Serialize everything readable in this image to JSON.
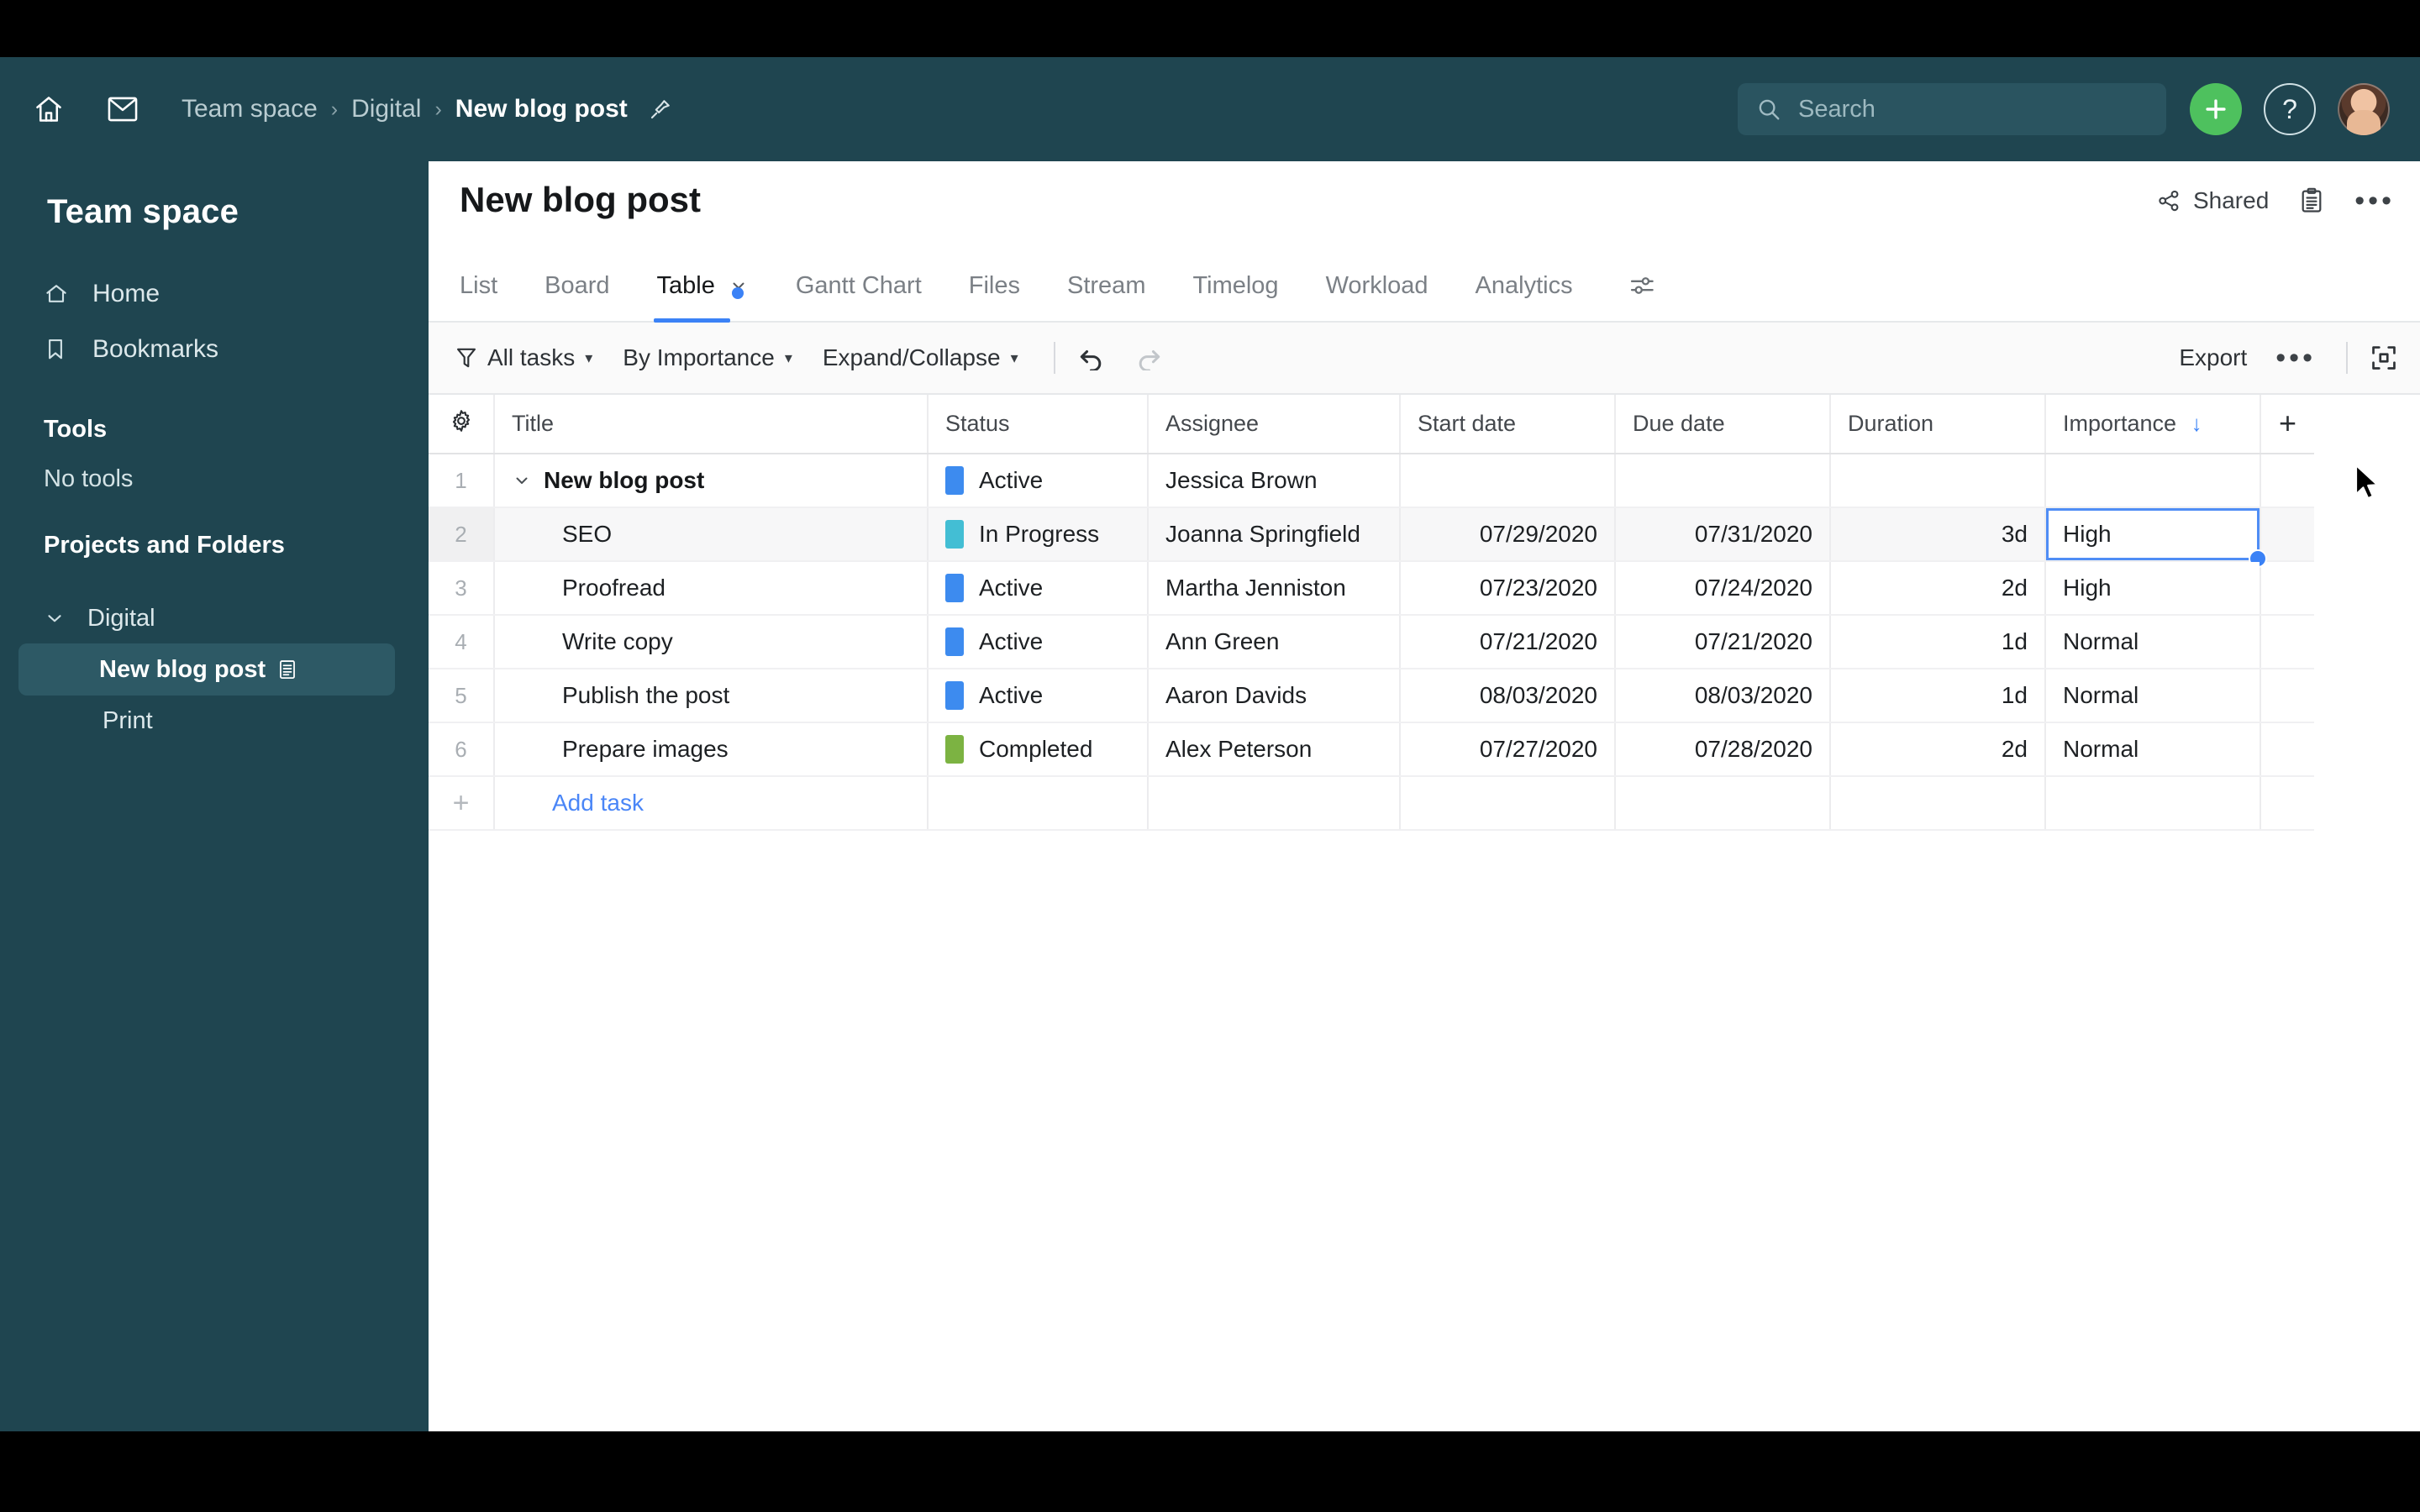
{
  "topbar": {
    "home_icon": "home-icon",
    "mail_icon": "mail-icon",
    "breadcrumbs": [
      {
        "label": "Team space",
        "active": false
      },
      {
        "label": "Digital",
        "active": false
      },
      {
        "label": "New blog post",
        "active": true
      }
    ],
    "separator": "›",
    "pin_icon": "pin-icon",
    "search": {
      "placeholder": "Search",
      "value": "",
      "icon": "search-icon"
    },
    "create_label": "+",
    "help_label": "?",
    "avatar": "user-avatar"
  },
  "sidebar": {
    "workspace_title": "Team space",
    "nav": [
      {
        "label": "Home",
        "icon": "home-icon"
      },
      {
        "label": "Bookmarks",
        "icon": "bookmark-icon"
      }
    ],
    "tools_heading": "Tools",
    "tools_empty": "No tools",
    "projects_heading": "Projects and Folders",
    "tree": [
      {
        "label": "Digital",
        "icon": "chevron-down-icon",
        "selected": false
      },
      {
        "label": "New blog post",
        "icon": "document-icon",
        "selected": true
      },
      {
        "label": "Print",
        "icon": "",
        "selected": false
      }
    ]
  },
  "main": {
    "page_title": "New blog post",
    "shared_label": "Shared",
    "share_icon": "share-icon",
    "clipboard_icon": "clipboard-icon",
    "more_icon": "more-horizontal-icon",
    "tabs": [
      {
        "label": "List",
        "active": false
      },
      {
        "label": "Board",
        "active": false
      },
      {
        "label": "Table",
        "active": true
      },
      {
        "label": "Gantt Chart",
        "active": false
      },
      {
        "label": "Files",
        "active": false
      },
      {
        "label": "Stream",
        "active": false
      },
      {
        "label": "Timelog",
        "active": false
      },
      {
        "label": "Workload",
        "active": false
      },
      {
        "label": "Analytics",
        "active": false
      }
    ],
    "tab_settings_icon": "sliders-icon",
    "toolbar": {
      "filter_label": "All tasks",
      "filter_icon": "filter-icon",
      "group_label": "By Importance",
      "expand_label": "Expand/Collapse",
      "caret": "▾",
      "undo_icon": "undo-icon",
      "redo_icon": "redo-icon",
      "export_label": "Export",
      "more_icon": "more-horizontal-icon",
      "fullscreen_icon": "fullscreen-icon"
    }
  },
  "table": {
    "gear_icon": "gear-icon",
    "add_column_icon": "plus-icon",
    "sort_icon": "↓",
    "columns": [
      {
        "key": "title",
        "label": "Title"
      },
      {
        "key": "status",
        "label": "Status"
      },
      {
        "key": "assignee",
        "label": "Assignee"
      },
      {
        "key": "start",
        "label": "Start date"
      },
      {
        "key": "due",
        "label": "Due date"
      },
      {
        "key": "duration",
        "label": "Duration"
      },
      {
        "key": "importance",
        "label": "Importance",
        "sorted": "desc"
      }
    ],
    "rows": [
      {
        "num": "1",
        "title": "New blog post",
        "is_root": true,
        "highlight": false,
        "status": "Active",
        "status_color": "#3d8bef",
        "assignee": "Jessica Brown",
        "start": "",
        "due": "",
        "duration": "",
        "importance": "",
        "selected": false
      },
      {
        "num": "2",
        "title": "SEO",
        "is_root": false,
        "highlight": true,
        "status": "In Progress",
        "status_color": "#43bed4",
        "assignee": "Joanna Springfield",
        "start": "07/29/2020",
        "due": "07/31/2020",
        "duration": "3d",
        "importance": "High",
        "selected": true
      },
      {
        "num": "3",
        "title": "Proofread",
        "is_root": false,
        "highlight": false,
        "status": "Active",
        "status_color": "#3d8bef",
        "assignee": "Martha Jenniston",
        "start": "07/23/2020",
        "due": "07/24/2020",
        "duration": "2d",
        "importance": "High",
        "selected": false
      },
      {
        "num": "4",
        "title": "Write copy",
        "is_root": false,
        "highlight": false,
        "status": "Active",
        "status_color": "#3d8bef",
        "assignee": "Ann Green",
        "start": "07/21/2020",
        "due": "07/21/2020",
        "duration": "1d",
        "importance": "Normal",
        "selected": false
      },
      {
        "num": "5",
        "title": "Publish the post",
        "is_root": false,
        "highlight": false,
        "status": "Active",
        "status_color": "#3d8bef",
        "assignee": "Aaron Davids",
        "start": "08/03/2020",
        "due": "08/03/2020",
        "duration": "1d",
        "importance": "Normal",
        "selected": false
      },
      {
        "num": "6",
        "title": "Prepare images",
        "is_root": false,
        "highlight": false,
        "status": "Completed",
        "status_color": "#7cb342",
        "assignee": "Alex Peterson",
        "start": "07/27/2020",
        "due": "07/28/2020",
        "duration": "2d",
        "importance": "Normal",
        "selected": false
      }
    ],
    "add_task_label": "Add task",
    "add_task_icon": "plus-icon"
  },
  "colors": {
    "header_bg": "#1f4550",
    "accent_green": "#4ec15e",
    "accent_blue": "#3b82f6",
    "status_active": "#3d8bef",
    "status_in_progress": "#43bed4",
    "status_completed": "#7cb342"
  }
}
